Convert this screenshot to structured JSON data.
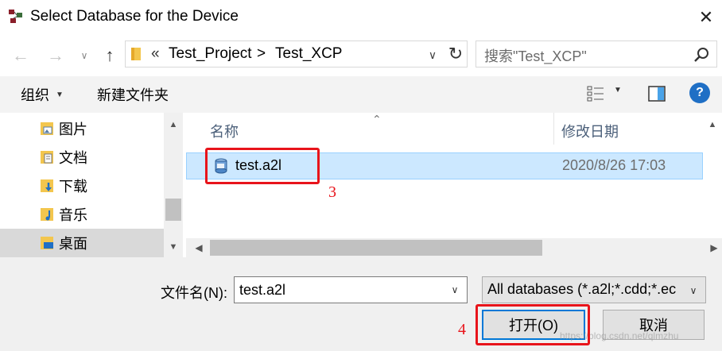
{
  "window": {
    "title": "Select Database for the Device",
    "close_glyph": "✕"
  },
  "address": {
    "overflow": "«",
    "crumbs": [
      "Test_Project",
      "Test_XCP"
    ],
    "separator": ">"
  },
  "search": {
    "placeholder": "搜索\"Test_XCP\""
  },
  "toolbar": {
    "organize_label": "组织",
    "new_folder_label": "新建文件夹"
  },
  "nav": {
    "items": [
      {
        "label": "图片",
        "icon": "pictures-folder-icon"
      },
      {
        "label": "文档",
        "icon": "documents-folder-icon"
      },
      {
        "label": "下载",
        "icon": "downloads-folder-icon"
      },
      {
        "label": "音乐",
        "icon": "music-folder-icon"
      },
      {
        "label": "桌面",
        "icon": "desktop-folder-icon",
        "selected": true
      }
    ]
  },
  "file_list": {
    "columns": {
      "name": "名称",
      "date": "修改日期"
    },
    "files": [
      {
        "name": "test.a2l",
        "modified": "2020/8/26 17:03",
        "selected": true
      }
    ]
  },
  "bottom": {
    "filename_label": "文件名(N):",
    "filename_value": "test.a2l",
    "filter_value": "All databases (*.a2l;*.cdd;*.ec",
    "open_label": "打开(O)",
    "cancel_label": "取消",
    "watermark": "https://blog.csdn.net/qlmzhu"
  },
  "annotations": {
    "step_3": "3",
    "step_4": "4"
  },
  "colors": {
    "accent": "#0078d7",
    "selection": "#cce8ff",
    "annotation_red": "#e8141b",
    "help_blue": "#1f6fc5"
  }
}
